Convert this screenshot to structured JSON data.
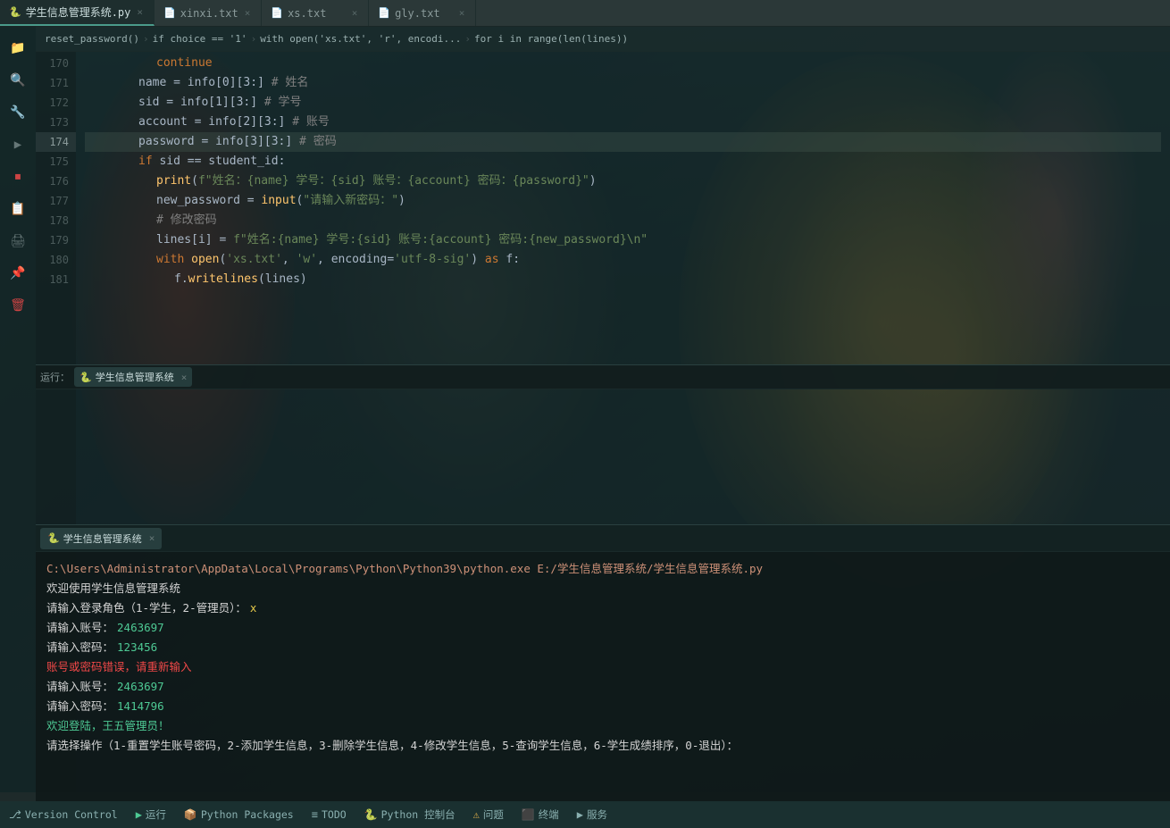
{
  "tabs": [
    {
      "id": "tab1",
      "icon": "🐍",
      "label": "学生信息管理系统.py",
      "active": true,
      "closeable": true
    },
    {
      "id": "tab2",
      "icon": "📄",
      "label": "xinxi.txt",
      "active": false,
      "closeable": true
    },
    {
      "id": "tab3",
      "icon": "📄",
      "label": "xs.txt",
      "active": false,
      "closeable": true
    },
    {
      "id": "tab4",
      "icon": "📄",
      "label": "gly.txt",
      "active": false,
      "closeable": true
    }
  ],
  "breadcrumb": {
    "parts": [
      "reset_password()",
      "if choice == '1'",
      "with open('xs.txt', 'r', encodi...",
      "for i in range(len(lines))"
    ]
  },
  "code_lines": [
    {
      "num": 170,
      "indent": 3,
      "content": "continue",
      "tokens": [
        {
          "t": "kw",
          "v": "continue"
        }
      ]
    },
    {
      "num": 171,
      "indent": 3,
      "content": "name = info[0][3:] # 姓名",
      "tokens": [
        {
          "t": "var",
          "v": "name"
        },
        {
          "t": "op",
          "v": " = "
        },
        {
          "t": "var",
          "v": "info"
        },
        {
          "t": "punc",
          "v": "[0][3:]"
        },
        {
          "t": "cmt",
          "v": " # 姓名"
        }
      ]
    },
    {
      "num": 172,
      "indent": 3,
      "content": "sid = info[1][3:] # 学号",
      "tokens": [
        {
          "t": "var",
          "v": "sid"
        },
        {
          "t": "op",
          "v": " = "
        },
        {
          "t": "var",
          "v": "info"
        },
        {
          "t": "punc",
          "v": "[1][3:]"
        },
        {
          "t": "cmt",
          "v": " # 学号"
        }
      ]
    },
    {
      "num": 173,
      "indent": 3,
      "content": "account = info[2][3:] # 账号",
      "tokens": [
        {
          "t": "var",
          "v": "account"
        },
        {
          "t": "op",
          "v": " = "
        },
        {
          "t": "var",
          "v": "info"
        },
        {
          "t": "punc",
          "v": "[2][3:]"
        },
        {
          "t": "cmt",
          "v": " # 账号"
        }
      ]
    },
    {
      "num": 174,
      "indent": 3,
      "content": "password = info[3][3:] # 密码",
      "tokens": [
        {
          "t": "var",
          "v": "password"
        },
        {
          "t": "op",
          "v": " = "
        },
        {
          "t": "var",
          "v": "info"
        },
        {
          "t": "punc",
          "v": "[3][3:]"
        },
        {
          "t": "cmt",
          "v": " # 密码"
        }
      ],
      "highlighted": true
    },
    {
      "num": 175,
      "indent": 3,
      "content": "if sid == student_id:",
      "tokens": [
        {
          "t": "kw",
          "v": "if "
        },
        {
          "t": "var",
          "v": "sid"
        },
        {
          "t": "op",
          "v": " == "
        },
        {
          "t": "var",
          "v": "student_id"
        },
        {
          "t": "punc",
          "v": ":"
        }
      ]
    },
    {
      "num": 176,
      "indent": 4,
      "content": "print(f\"姓名：{name} 学号：{sid} 账号：{account} 密码：{password}\")",
      "tokens": [
        {
          "t": "fn",
          "v": "print"
        },
        {
          "t": "punc",
          "v": "("
        },
        {
          "t": "str",
          "v": "f\"姓名：{name} 学号：{sid} 账号：{account} 密码：{password}\""
        },
        {
          "t": "punc",
          "v": ")"
        }
      ]
    },
    {
      "num": 177,
      "indent": 4,
      "content": "new_password = input(\"请输入新密码：\")",
      "tokens": [
        {
          "t": "var",
          "v": "new_password"
        },
        {
          "t": "op",
          "v": " = "
        },
        {
          "t": "fn",
          "v": "input"
        },
        {
          "t": "punc",
          "v": "("
        },
        {
          "t": "str",
          "v": "\"请输入新密码：\""
        },
        {
          "t": "punc",
          "v": ")"
        }
      ]
    },
    {
      "num": 178,
      "indent": 4,
      "content": "# 修改密码",
      "tokens": [
        {
          "t": "cmt",
          "v": "# 修改密码"
        }
      ]
    },
    {
      "num": 179,
      "indent": 4,
      "content": "lines[i] = f\"姓名:{name} 学号:{sid} 账号:{account} 密码:{new_password}\\n\"",
      "tokens": [
        {
          "t": "var",
          "v": "lines"
        },
        {
          "t": "punc",
          "v": "[i]"
        },
        {
          "t": "op",
          "v": " = "
        },
        {
          "t": "str",
          "v": "f\"姓名:{name} 学号:{sid} 账号:{account} 密码:{new_password}\\n\""
        }
      ]
    },
    {
      "num": 180,
      "indent": 4,
      "content": "with open('xs.txt', 'w', encoding='utf-8-sig') as f:",
      "tokens": [
        {
          "t": "kw",
          "v": "with "
        },
        {
          "t": "fn",
          "v": "open"
        },
        {
          "t": "punc",
          "v": "("
        },
        {
          "t": "str",
          "v": "'xs.txt'"
        },
        {
          "t": "punc",
          "v": ", "
        },
        {
          "t": "str",
          "v": "'w'"
        },
        {
          "t": "punc",
          "v": ", "
        },
        {
          "t": "var",
          "v": "encoding"
        },
        {
          "t": "op",
          "v": "="
        },
        {
          "t": "str",
          "v": "'utf-8-sig'"
        },
        {
          "t": "punc",
          "v": ")"
        },
        {
          "t": "kw",
          "v": " as "
        },
        {
          "t": "var",
          "v": "f"
        },
        {
          "t": "punc",
          "v": ":"
        }
      ]
    },
    {
      "num": 181,
      "indent": 5,
      "content": "f.writelines(lines)",
      "tokens": [
        {
          "t": "var",
          "v": "f"
        },
        {
          "t": "punc",
          "v": "."
        },
        {
          "t": "fn",
          "v": "writelines"
        },
        {
          "t": "punc",
          "v": "("
        },
        {
          "t": "var",
          "v": "lines"
        },
        {
          "t": "punc",
          "v": ")"
        }
      ]
    }
  ],
  "run_bar": {
    "label": "运行：",
    "active_run": "🐍 学生信息管理系统",
    "close": "×"
  },
  "terminal": {
    "tabs": [
      {
        "label": "🐍 学生信息管理系统",
        "active": true,
        "closeable": true
      }
    ],
    "lines": [
      {
        "type": "path",
        "text": "C:\\Users\\Administrator\\AppData\\Local\\Programs\\Python\\Python39\\python.exe E:/学生信息管理系统/学生信息管理系统.py"
      },
      {
        "type": "white",
        "text": "欢迎使用学生信息管理系统"
      },
      {
        "type": "white",
        "text": "请输入登录角色（1-学生，2-管理员）：x"
      },
      {
        "type": "white",
        "text": "请输入账号：",
        "suffix_green": "2463697"
      },
      {
        "type": "white",
        "text": "请输入密码：",
        "suffix_green": "123456"
      },
      {
        "type": "red",
        "text": "账号或密码错误，请重新输入"
      },
      {
        "type": "white",
        "text": "请输入账号：",
        "suffix_green": "2463697"
      },
      {
        "type": "white",
        "text": "请输入密码：",
        "suffix_green": "1414796"
      },
      {
        "type": "green",
        "text": "欢迎登陆，王五管理员！"
      },
      {
        "type": "white",
        "text": "请选择操作（1-重置学生账号密码，2-添加学生信息，3-删除学生信息，4-修改学生信息，5-查询学生信息，6-学生成绩排序，0-退出）："
      }
    ]
  },
  "status_bar": {
    "items": [
      {
        "icon": "⎇",
        "label": "Version Control"
      },
      {
        "icon": "▶",
        "label": "运行"
      },
      {
        "icon": "📦",
        "label": "Python Packages"
      },
      {
        "icon": "≡",
        "label": "TODO"
      },
      {
        "icon": "🐍",
        "label": "Python 控制台"
      },
      {
        "icon": "⚠",
        "label": "问题"
      },
      {
        "icon": "⬛",
        "label": "终端"
      },
      {
        "icon": "▶",
        "label": "服务"
      }
    ]
  },
  "activity_icons": [
    "📁",
    "🔍",
    "🔧",
    "▶",
    "⏹",
    "📋",
    "🖨",
    "📌",
    "🗑"
  ]
}
